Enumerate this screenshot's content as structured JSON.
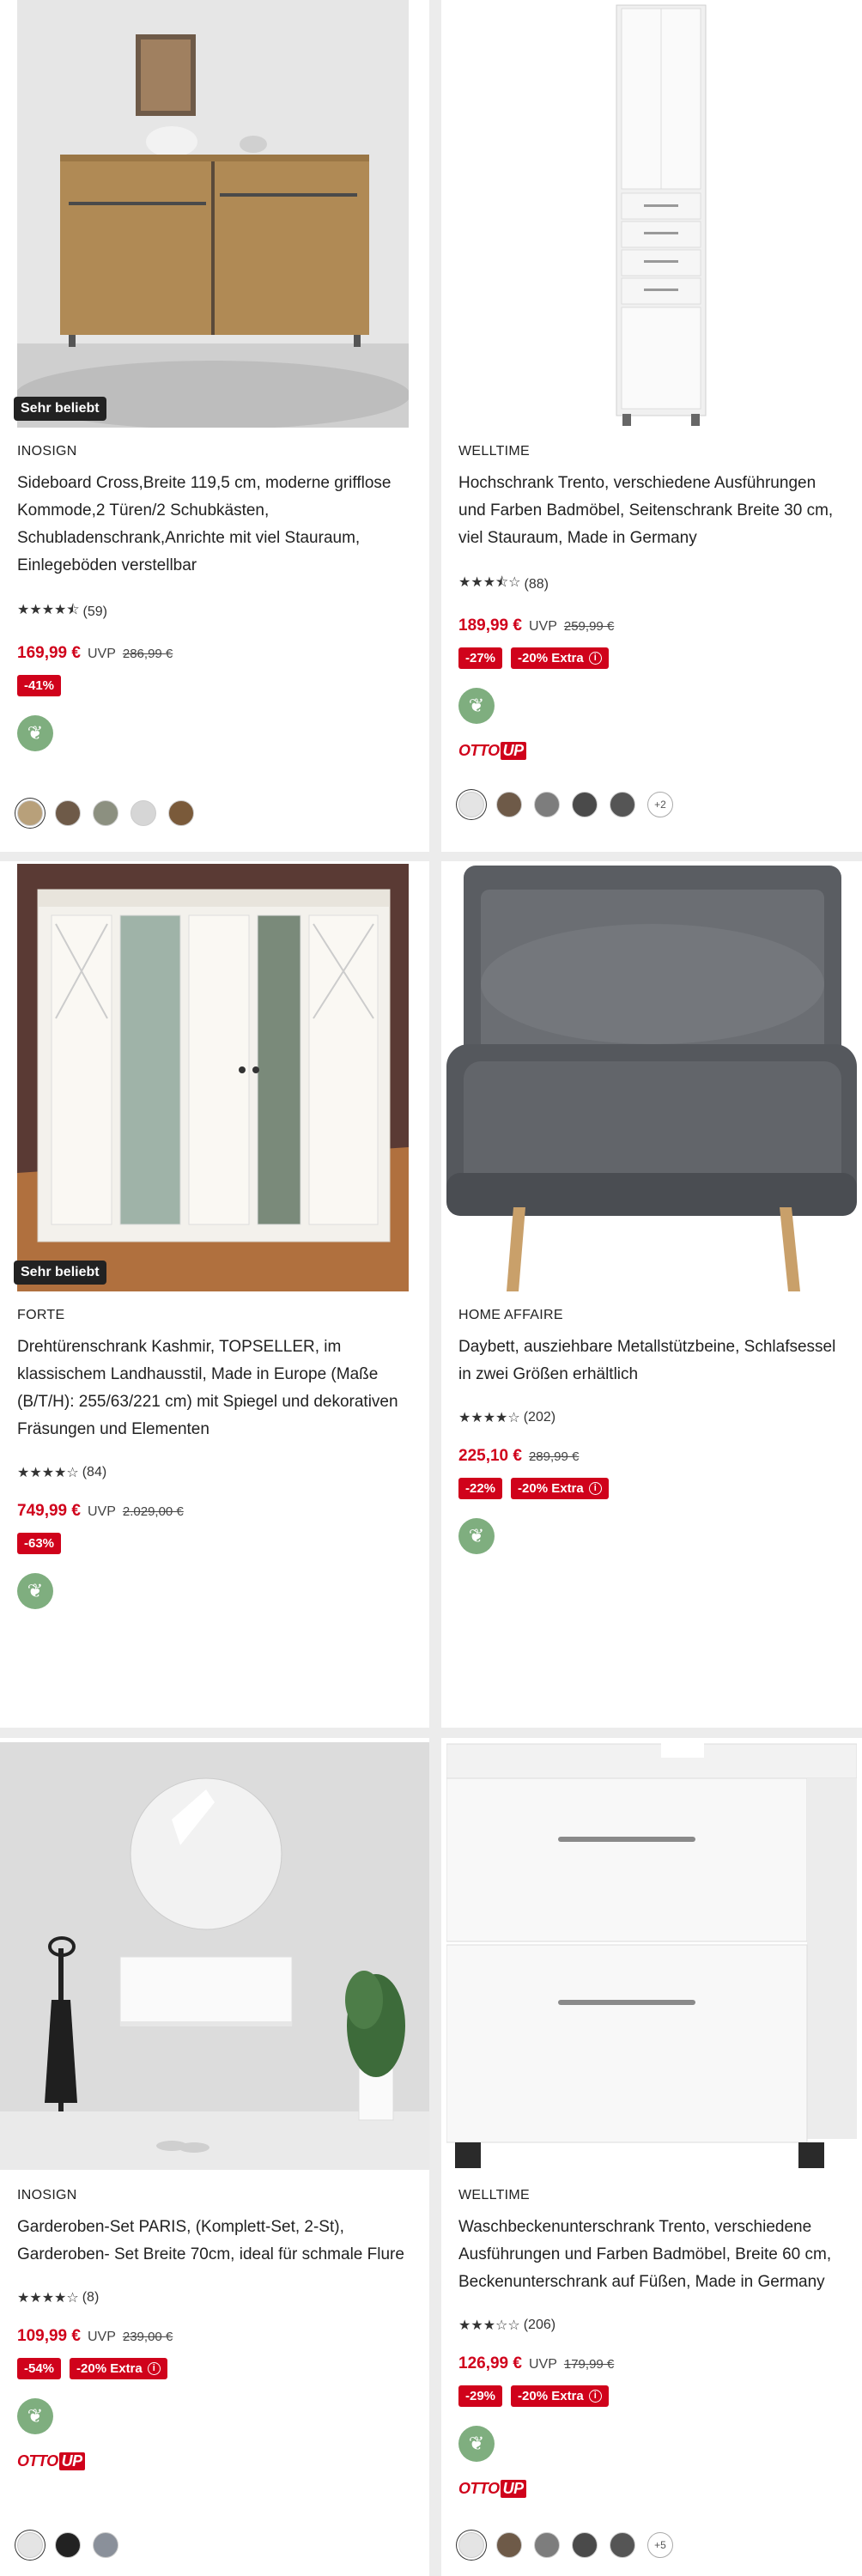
{
  "products": [
    {
      "badge": "Sehr beliebt",
      "brand": "INOSIGN",
      "title": "Sideboard Cross,Breite 119,5 cm, moderne grifflose Kommode,2 Türen/2 Schubkästen, Schubladenschrank,Anrichte mit viel Stauraum, Einlegeböden verstellbar",
      "stars": "★★★★⯪",
      "reviews": "(59)",
      "price": "169,99 €",
      "uvp": "UVP",
      "old_price": "286,99 €",
      "tags": [
        "-41%"
      ],
      "swatches": [
        "#b8a07a",
        "#6e5a48",
        "#8c9080",
        "#d6d6d6",
        "#7a5a3a"
      ],
      "swatch_more": ""
    },
    {
      "badge": "",
      "brand": "WELLTIME",
      "title": "Hochschrank Trento, verschiedene Ausführungen und Farben Badmöbel, Seitenschrank Breite 30 cm, viel Stauraum, Made in Germany",
      "stars": "★★★⯪☆",
      "reviews": "(88)",
      "price": "189,99 €",
      "uvp": "UVP",
      "old_price": "259,99 €",
      "tags": [
        "-27%",
        "-20% Extra"
      ],
      "ottoup": "OTTO",
      "ottoup_tag": "UP",
      "swatches": [
        "#e4e4e4",
        "#6e5a48",
        "#7d7d7d",
        "#4a4a4a",
        "#555555"
      ],
      "swatch_more": "+2"
    },
    {
      "badge": "Sehr beliebt",
      "brand": "FORTE",
      "title": "Drehtürenschrank Kashmir, TOPSELLER, im klassischem Landhausstil, Made in Europe (Maße (B/T/H): 255/63/221 cm) mit Spiegel und dekorativen Fräsungen und Elementen",
      "stars": "★★★★☆",
      "reviews": "(84)",
      "price": "749,99 €",
      "uvp": "UVP",
      "old_price": "2.029,00 €",
      "tags": [
        "-63%"
      ]
    },
    {
      "badge": "",
      "brand": "HOME AFFAIRE",
      "title": "Daybett, ausziehbare Metallstützbeine, Schlafsessel in zwei Größen erhältlich",
      "stars": "★★★★☆",
      "reviews": "(202)",
      "price": "225,10 €",
      "uvp": "",
      "old_price": "289,99 €",
      "tags": [
        "-22%",
        "-20% Extra"
      ]
    },
    {
      "badge": "",
      "brand": "INOSIGN",
      "title": "Garderoben-Set PARIS, (Komplett-Set, 2-St), Garderoben- Set Breite 70cm, ideal für schmale Flure",
      "stars": "★★★★☆",
      "reviews": "(8)",
      "price": "109,99 €",
      "uvp": "UVP",
      "old_price": "239,00 €",
      "tags": [
        "-54%",
        "-20% Extra"
      ],
      "ottoup": "OTTO",
      "ottoup_tag": "UP",
      "swatches": [
        "#e4e4e4",
        "#222222",
        "#8a909a"
      ],
      "swatch_more": ""
    },
    {
      "badge": "",
      "brand": "WELLTIME",
      "title": "Waschbeckenunterschrank Trento, verschiedene Ausführungen und Farben Badmöbel, Breite 60 cm, Beckenunterschrank auf Füßen, Made in Germany",
      "stars": "★★★☆☆",
      "reviews": "(206)",
      "price": "126,99 €",
      "uvp": "UVP",
      "old_price": "179,99 €",
      "tags": [
        "-29%",
        "-20% Extra"
      ],
      "ottoup": "OTTO",
      "ottoup_tag": "UP",
      "swatches": [
        "#e4e4e4",
        "#6e5a48",
        "#7d7d7d",
        "#4a4a4a",
        "#555555"
      ],
      "swatch_more": "+5"
    }
  ],
  "colors": {
    "price_red": "#d0021b",
    "eco_green": "#7fae7f"
  }
}
